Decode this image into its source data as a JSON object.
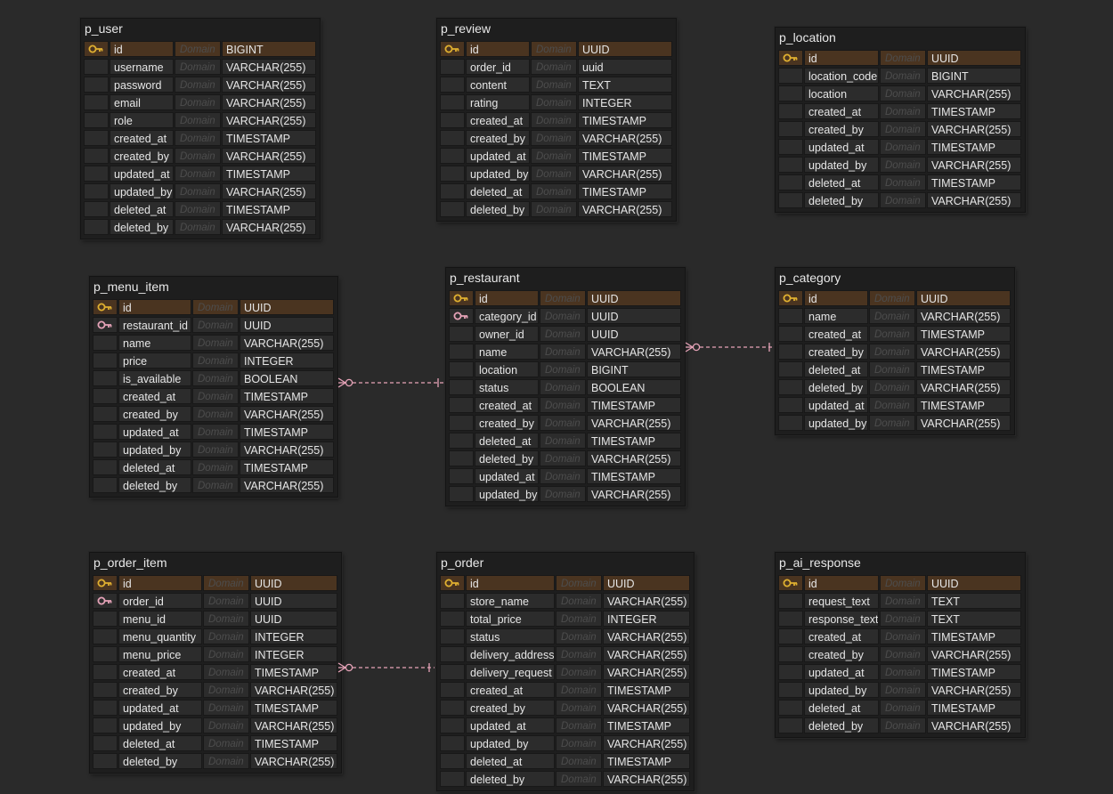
{
  "domain_placeholder": "Domain",
  "colors": {
    "pk_row": "#4a3420",
    "key_icon": "#e0b030",
    "fk_icon": "#e6a3b8",
    "relation_line": "#e6a3b8"
  },
  "tables": [
    {
      "title": "p_user",
      "rows": [
        {
          "key": "pk",
          "name": "id",
          "type": "BIGINT"
        },
        {
          "key": "",
          "name": "username",
          "type": "VARCHAR(255)"
        },
        {
          "key": "",
          "name": "password",
          "type": "VARCHAR(255)"
        },
        {
          "key": "",
          "name": "email",
          "type": "VARCHAR(255)"
        },
        {
          "key": "",
          "name": "role",
          "type": "VARCHAR(255)"
        },
        {
          "key": "",
          "name": "created_at",
          "type": "TIMESTAMP"
        },
        {
          "key": "",
          "name": "created_by",
          "type": "VARCHAR(255)"
        },
        {
          "key": "",
          "name": "updated_at",
          "type": "TIMESTAMP"
        },
        {
          "key": "",
          "name": "updated_by",
          "type": "VARCHAR(255)"
        },
        {
          "key": "",
          "name": "deleted_at",
          "type": "TIMESTAMP"
        },
        {
          "key": "",
          "name": "deleted_by",
          "type": "VARCHAR(255)"
        }
      ]
    },
    {
      "title": "p_review",
      "rows": [
        {
          "key": "pk",
          "name": "id",
          "type": "UUID"
        },
        {
          "key": "",
          "name": "order_id",
          "type": "uuid"
        },
        {
          "key": "",
          "name": "content",
          "type": "TEXT"
        },
        {
          "key": "",
          "name": "rating",
          "type": "INTEGER"
        },
        {
          "key": "",
          "name": "created_at",
          "type": "TIMESTAMP"
        },
        {
          "key": "",
          "name": "created_by",
          "type": "VARCHAR(255)"
        },
        {
          "key": "",
          "name": "updated_at",
          "type": "TIMESTAMP"
        },
        {
          "key": "",
          "name": "updated_by",
          "type": "VARCHAR(255)"
        },
        {
          "key": "",
          "name": "deleted_at",
          "type": "TIMESTAMP"
        },
        {
          "key": "",
          "name": "deleted_by",
          "type": "VARCHAR(255)"
        }
      ]
    },
    {
      "title": "p_location",
      "rows": [
        {
          "key": "pk",
          "name": "id",
          "type": "UUID"
        },
        {
          "key": "",
          "name": "location_code",
          "type": "BIGINT"
        },
        {
          "key": "",
          "name": "location",
          "type": "VARCHAR(255)"
        },
        {
          "key": "",
          "name": "created_at",
          "type": "TIMESTAMP"
        },
        {
          "key": "",
          "name": "created_by",
          "type": "VARCHAR(255)"
        },
        {
          "key": "",
          "name": "updated_at",
          "type": "TIMESTAMP"
        },
        {
          "key": "",
          "name": "updated_by",
          "type": "VARCHAR(255)"
        },
        {
          "key": "",
          "name": "deleted_at",
          "type": "TIMESTAMP"
        },
        {
          "key": "",
          "name": "deleted_by",
          "type": "VARCHAR(255)"
        }
      ]
    },
    {
      "title": "p_menu_item",
      "rows": [
        {
          "key": "pk",
          "name": "id",
          "type": "UUID"
        },
        {
          "key": "fk",
          "name": "restaurant_id",
          "type": "UUID"
        },
        {
          "key": "",
          "name": "name",
          "type": "VARCHAR(255)"
        },
        {
          "key": "",
          "name": "price",
          "type": "INTEGER"
        },
        {
          "key": "",
          "name": "is_available",
          "type": "BOOLEAN"
        },
        {
          "key": "",
          "name": "created_at",
          "type": "TIMESTAMP"
        },
        {
          "key": "",
          "name": "created_by",
          "type": "VARCHAR(255)"
        },
        {
          "key": "",
          "name": "updated_at",
          "type": "TIMESTAMP"
        },
        {
          "key": "",
          "name": "updated_by",
          "type": "VARCHAR(255)"
        },
        {
          "key": "",
          "name": "deleted_at",
          "type": "TIMESTAMP"
        },
        {
          "key": "",
          "name": "deleted_by",
          "type": "VARCHAR(255)"
        }
      ]
    },
    {
      "title": "p_restaurant",
      "rows": [
        {
          "key": "pk",
          "name": "id",
          "type": "UUID"
        },
        {
          "key": "fk",
          "name": "category_id",
          "type": "UUID"
        },
        {
          "key": "",
          "name": "owner_id",
          "type": "UUID"
        },
        {
          "key": "",
          "name": "name",
          "type": "VARCHAR(255)"
        },
        {
          "key": "",
          "name": "location",
          "type": "BIGINT"
        },
        {
          "key": "",
          "name": "status",
          "type": "BOOLEAN"
        },
        {
          "key": "",
          "name": "created_at",
          "type": "TIMESTAMP"
        },
        {
          "key": "",
          "name": "created_by",
          "type": "VARCHAR(255)"
        },
        {
          "key": "",
          "name": "deleted_at",
          "type": "TIMESTAMP"
        },
        {
          "key": "",
          "name": "deleted_by",
          "type": "VARCHAR(255)"
        },
        {
          "key": "",
          "name": "updated_at",
          "type": "TIMESTAMP"
        },
        {
          "key": "",
          "name": "updated_by",
          "type": "VARCHAR(255)"
        }
      ]
    },
    {
      "title": "p_category",
      "rows": [
        {
          "key": "pk",
          "name": "id",
          "type": "UUID"
        },
        {
          "key": "",
          "name": "name",
          "type": "VARCHAR(255)"
        },
        {
          "key": "",
          "name": "created_at",
          "type": "TIMESTAMP"
        },
        {
          "key": "",
          "name": "created_by",
          "type": "VARCHAR(255)"
        },
        {
          "key": "",
          "name": "deleted_at",
          "type": "TIMESTAMP"
        },
        {
          "key": "",
          "name": "deleted_by",
          "type": "VARCHAR(255)"
        },
        {
          "key": "",
          "name": "updated_at",
          "type": "TIMESTAMP"
        },
        {
          "key": "",
          "name": "updated_by",
          "type": "VARCHAR(255)"
        }
      ]
    },
    {
      "title": "p_order_item",
      "rows": [
        {
          "key": "pk",
          "name": "id",
          "type": "UUID"
        },
        {
          "key": "fk",
          "name": "order_id",
          "type": "UUID"
        },
        {
          "key": "",
          "name": "menu_id",
          "type": "UUID"
        },
        {
          "key": "",
          "name": "menu_quantity",
          "type": "INTEGER"
        },
        {
          "key": "",
          "name": "menu_price",
          "type": "INTEGER"
        },
        {
          "key": "",
          "name": "created_at",
          "type": "TIMESTAMP"
        },
        {
          "key": "",
          "name": "created_by",
          "type": "VARCHAR(255)"
        },
        {
          "key": "",
          "name": "updated_at",
          "type": "TIMESTAMP"
        },
        {
          "key": "",
          "name": "updated_by",
          "type": "VARCHAR(255)"
        },
        {
          "key": "",
          "name": "deleted_at",
          "type": "TIMESTAMP"
        },
        {
          "key": "",
          "name": "deleted_by",
          "type": "VARCHAR(255)"
        }
      ]
    },
    {
      "title": "p_order",
      "rows": [
        {
          "key": "pk",
          "name": "id",
          "type": "UUID"
        },
        {
          "key": "",
          "name": "store_name",
          "type": "VARCHAR(255)"
        },
        {
          "key": "",
          "name": "total_price",
          "type": "INTEGER"
        },
        {
          "key": "",
          "name": "status",
          "type": "VARCHAR(255)"
        },
        {
          "key": "",
          "name": "delivery_address",
          "type": "VARCHAR(255)"
        },
        {
          "key": "",
          "name": "delivery_request",
          "type": "VARCHAR(255)"
        },
        {
          "key": "",
          "name": "created_at",
          "type": "TIMESTAMP"
        },
        {
          "key": "",
          "name": "created_by",
          "type": "VARCHAR(255)"
        },
        {
          "key": "",
          "name": "updated_at",
          "type": "TIMESTAMP"
        },
        {
          "key": "",
          "name": "updated_by",
          "type": "VARCHAR(255)"
        },
        {
          "key": "",
          "name": "deleted_at",
          "type": "TIMESTAMP"
        },
        {
          "key": "",
          "name": "deleted_by",
          "type": "VARCHAR(255)"
        }
      ]
    },
    {
      "title": "p_ai_response",
      "rows": [
        {
          "key": "pk",
          "name": "id",
          "type": "UUID"
        },
        {
          "key": "",
          "name": "request_text",
          "type": "TEXT"
        },
        {
          "key": "",
          "name": "response_text",
          "type": "TEXT"
        },
        {
          "key": "",
          "name": "created_at",
          "type": "TIMESTAMP"
        },
        {
          "key": "",
          "name": "created_by",
          "type": "VARCHAR(255)"
        },
        {
          "key": "",
          "name": "updated_at",
          "type": "TIMESTAMP"
        },
        {
          "key": "",
          "name": "updated_by",
          "type": "VARCHAR(255)"
        },
        {
          "key": "",
          "name": "deleted_at",
          "type": "TIMESTAMP"
        },
        {
          "key": "",
          "name": "deleted_by",
          "type": "VARCHAR(255)"
        }
      ]
    }
  ],
  "relationships": [
    {
      "from": "p_menu_item",
      "to": "p_restaurant"
    },
    {
      "from": "p_restaurant",
      "to": "p_category"
    },
    {
      "from": "p_order_item",
      "to": "p_order"
    }
  ]
}
